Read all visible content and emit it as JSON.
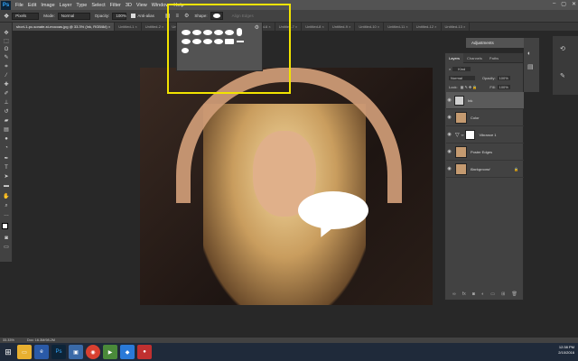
{
  "menubar": {
    "logo": "Ps",
    "items": [
      "File",
      "Edit",
      "Image",
      "Layer",
      "Type",
      "Select",
      "Filter",
      "3D",
      "View",
      "Window",
      "Help"
    ],
    "window_controls": [
      "–",
      "▢",
      "✕"
    ]
  },
  "options_bar": {
    "tool_mode": "Pixels",
    "mode_label": "Mode:",
    "mode_value": "Normal",
    "opacity_label": "Opacity:",
    "opacity_value": "100%",
    "antialias_label": "Anti-alias",
    "shape_label": "Shape:",
    "align_edges_label": "Align Edges"
  },
  "document_tabs": [
    {
      "label": "short-1-pc-sonate-st-mocoas.jpg @ 33.3% (Ink, RGB/8#) ×",
      "active": true
    },
    {
      "label": "Untitled-1 ×",
      "active": false
    },
    {
      "label": "Untitled-2 ×",
      "active": false
    },
    {
      "label": "Untitled-3 ×",
      "active": false
    },
    {
      "label": "Untitled-4 ×",
      "active": false
    },
    {
      "label": "Untitled-5 ×",
      "active": false
    },
    {
      "label": "Untitled-6 ×",
      "active": false
    },
    {
      "label": "Untitled-7 ×",
      "active": false
    },
    {
      "label": "Untitled-8 ×",
      "active": false
    },
    {
      "label": "Untitled-9 ×",
      "active": false
    },
    {
      "label": "Untitled-10 ×",
      "active": false
    },
    {
      "label": "Untitled-11 ×",
      "active": false
    },
    {
      "label": "Untitled-12 ×",
      "active": false
    },
    {
      "label": "Untitled-13 ×",
      "active": false
    }
  ],
  "panels": {
    "adjustments_title": "Adjustments",
    "layers_tabs": [
      "Layers",
      "Channels",
      "Paths"
    ],
    "kind_label": "Kind",
    "blend_mode": "Normal",
    "opacity_label": "Opacity:",
    "opacity_value": "100%",
    "lock_label": "Lock:",
    "fill_label": "Fill:",
    "fill_value": "100%",
    "layers": [
      {
        "name": "Ink",
        "selected": true,
        "thumb": "mask"
      },
      {
        "name": "Color",
        "selected": false,
        "thumb": "photo"
      },
      {
        "name": "Vibrance 1",
        "selected": false,
        "thumb": "mask"
      },
      {
        "name": "Poster Edges",
        "selected": false,
        "thumb": "photo"
      },
      {
        "name": "Background",
        "selected": false,
        "thumb": "photo"
      }
    ]
  },
  "status_bar": {
    "zoom": "33.33%",
    "doc_info": "Doc: 16.3M/98.2M"
  },
  "taskbar": {
    "time": "12:38 PM",
    "date": "2/10/2016"
  },
  "colors": {
    "highlight": "#f2e400",
    "ps_blue": "#31a8ff"
  }
}
